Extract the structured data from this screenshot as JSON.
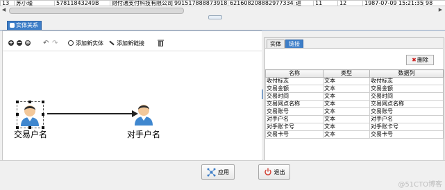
{
  "top_row": [
    "苏小瑾",
    "57811843249B",
    "财付通支付科技有限公司",
    "9915178888739188",
    "6216082088829773344",
    "进",
    "11",
    "12",
    "1987-07-09 15:21:35",
    "98"
  ],
  "tab_label": "实体关系",
  "toolbar": {
    "add_entity": "添加新实体",
    "add_link": "添加新链接"
  },
  "graph": {
    "nodes": [
      {
        "label": "交易户名",
        "selected": true
      },
      {
        "label": "对手户名",
        "selected": false
      }
    ],
    "edge": {
      "from": "交易户名",
      "to": "对手户名"
    }
  },
  "right_panel": {
    "tabs": [
      "实体",
      "链接"
    ],
    "active_tab": "链接",
    "delete_label": "删除",
    "columns": [
      "名称",
      "类型",
      "数据列"
    ],
    "rows": [
      [
        "收付标志",
        "文本",
        "收付标志"
      ],
      [
        "交易金额",
        "文本",
        "交易金额"
      ],
      [
        "交易时间",
        "文本",
        "交易时间"
      ],
      [
        "交易网点名称",
        "文本",
        "交易网点名称"
      ],
      [
        "交易账号",
        "文本",
        "交易账号"
      ],
      [
        "对手户名",
        "文本",
        "对手户名"
      ],
      [
        "对手账卡号",
        "文本",
        "对手账卡号"
      ],
      [
        "交易卡号",
        "文本",
        "交易卡号"
      ]
    ]
  },
  "buttons": {
    "apply": "应用",
    "exit": "退出"
  },
  "watermark": "@51CTO博客",
  "colors": {
    "accent": "#3d7ec8",
    "exit_icon": "#d23b2e"
  }
}
